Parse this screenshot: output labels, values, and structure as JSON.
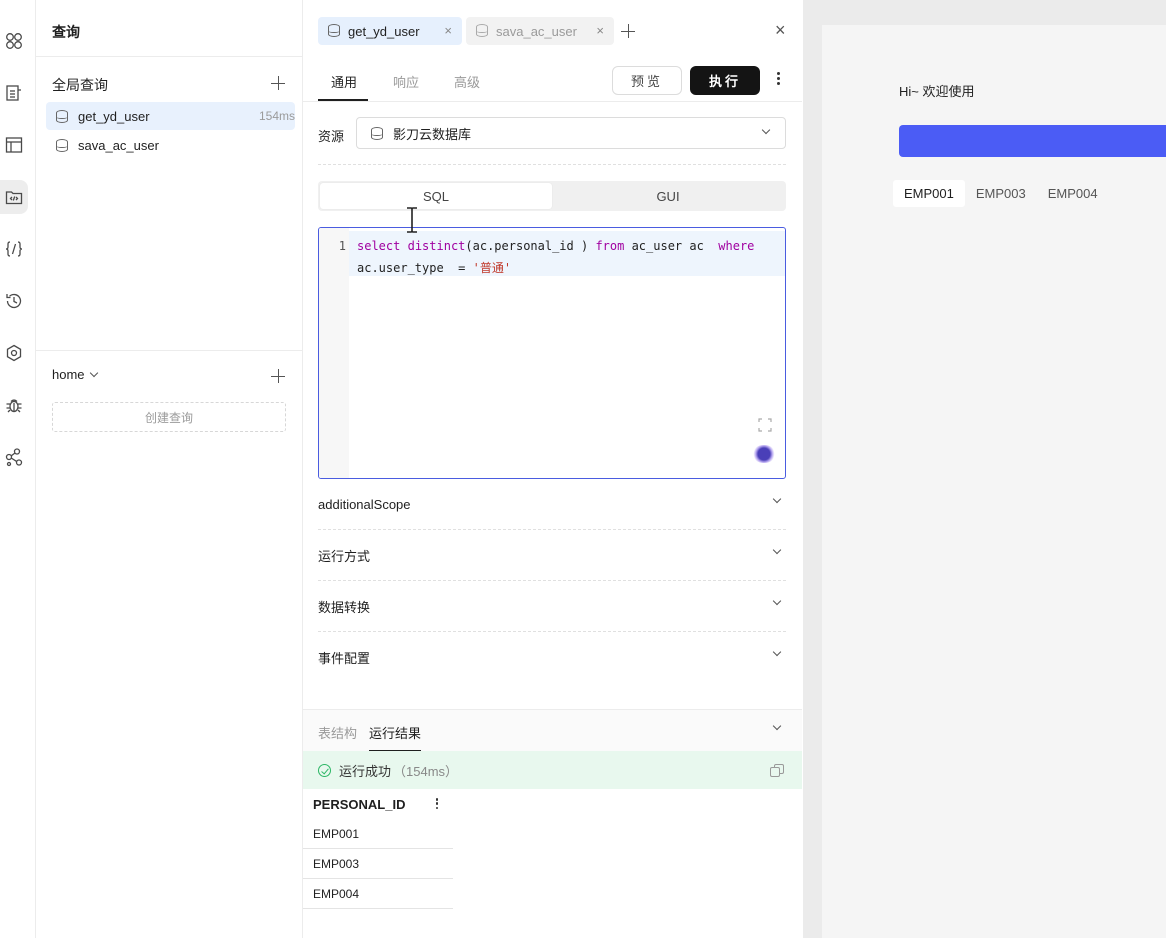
{
  "rail": {
    "icons": [
      "apps-icon",
      "page-icon",
      "layout-icon",
      "query-icon",
      "code-icon",
      "history-icon",
      "settings-icon",
      "debug-icon",
      "graph-icon"
    ]
  },
  "queries": {
    "title": "查询",
    "global_section": "全局查询",
    "items": [
      {
        "name": "get_yd_user",
        "time": "154ms"
      },
      {
        "name": "sava_ac_user",
        "time": ""
      }
    ],
    "home_section": "home",
    "create_label": "创建查询"
  },
  "editor": {
    "tabs": [
      {
        "label": "get_yd_user",
        "close": "×"
      },
      {
        "label": "sava_ac_user",
        "close": "×"
      }
    ],
    "close_panel": "×",
    "subtabs": [
      "通用",
      "响应",
      "高级"
    ],
    "preview_label": "预览",
    "run_label": "执行",
    "resource_label": "资源",
    "resource_value": "影刀云数据库",
    "mode_options": [
      "SQL",
      "GUI"
    ],
    "code": {
      "line_number": "1",
      "line1_kw1": "select",
      "line1_kw2": "distinct",
      "line1_text1": "(ac.personal_id ) ",
      "line1_kw3": "from",
      "line1_text2": " ac_user ac  ",
      "line1_kw4": "where",
      "line2_text": "ac.user_type  = ",
      "line2_str": "'普通'"
    },
    "accordions": [
      "additionalScope",
      "运行方式",
      "数据转换",
      "事件配置"
    ]
  },
  "results": {
    "tabs": [
      "表结构",
      "运行结果"
    ],
    "status": "运行成功",
    "duration": "（154ms）",
    "column": "PERSONAL_ID",
    "rows": [
      "EMP001",
      "EMP003",
      "EMP004"
    ]
  },
  "preview": {
    "greeting": "Hi~ 欢迎使用",
    "chips": [
      "EMP001",
      "EMP003",
      "EMP004"
    ],
    "accent": "#4b5cf5"
  }
}
